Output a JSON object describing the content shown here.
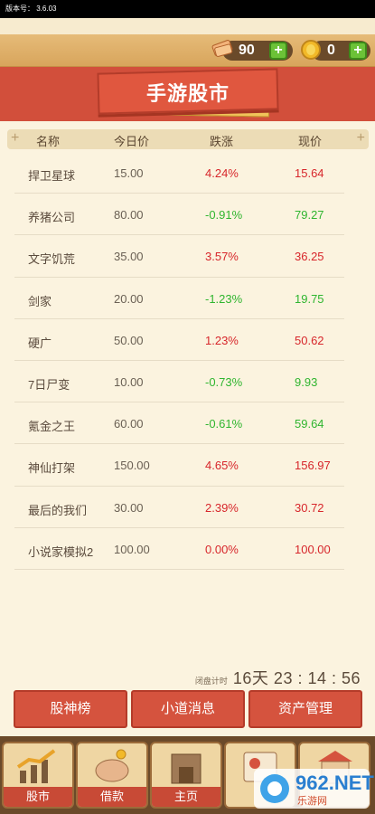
{
  "status": {
    "version": "版本号： 3.6.03"
  },
  "resources": {
    "tickets": "90",
    "coins": "0",
    "plus": "+"
  },
  "title": "手游股市",
  "table": {
    "headers": [
      "名称",
      "今日价",
      "跌涨",
      "现价"
    ],
    "rows": [
      {
        "name": "捍卫星球",
        "prev": "15.00",
        "chg": "4.24%",
        "now": "15.64",
        "dir": "up"
      },
      {
        "name": "养猪公司",
        "prev": "80.00",
        "chg": "-0.91%",
        "now": "79.27",
        "dir": "down"
      },
      {
        "name": "文字饥荒",
        "prev": "35.00",
        "chg": "3.57%",
        "now": "36.25",
        "dir": "up"
      },
      {
        "name": "剑家",
        "prev": "20.00",
        "chg": "-1.23%",
        "now": "19.75",
        "dir": "down"
      },
      {
        "name": "硬广",
        "prev": "50.00",
        "chg": "1.23%",
        "now": "50.62",
        "dir": "up"
      },
      {
        "name": "7日尸变",
        "prev": "10.00",
        "chg": "-0.73%",
        "now": "9.93",
        "dir": "down"
      },
      {
        "name": "氪金之王",
        "prev": "60.00",
        "chg": "-0.61%",
        "now": "59.64",
        "dir": "down"
      },
      {
        "name": "神仙打架",
        "prev": "150.00",
        "chg": "4.65%",
        "now": "156.97",
        "dir": "up"
      },
      {
        "name": "最后的我们",
        "prev": "30.00",
        "chg": "2.39%",
        "now": "30.72",
        "dir": "up"
      },
      {
        "name": "小说家模拟2",
        "prev": "100.00",
        "chg": "0.00%",
        "now": "100.00",
        "dir": "up"
      }
    ]
  },
  "countdown": {
    "label": "闭盘计时",
    "value": "16天 23 : 14 : 56"
  },
  "buttons": [
    "股神榜",
    "小道消息",
    "资产管理"
  ],
  "nav": {
    "tabs": [
      "股市",
      "借款",
      "主页"
    ]
  },
  "watermark": {
    "text": "962.NET",
    "sub": "乐游网"
  },
  "colors": {
    "up": "#d7262b",
    "down": "#2fb52f",
    "accent": "#d24f3b"
  }
}
